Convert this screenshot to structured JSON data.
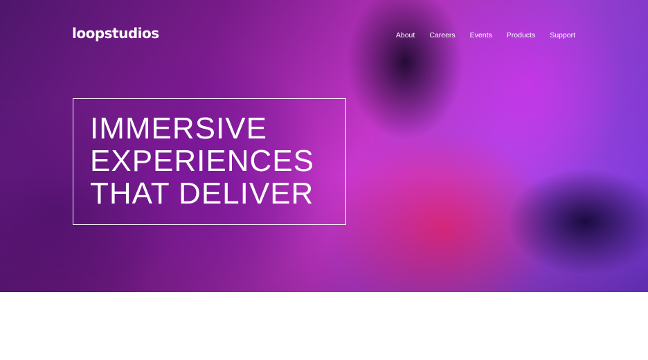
{
  "header": {
    "logo": "loopstudios",
    "nav": [
      "About",
      "Careers",
      "Events",
      "Products",
      "Support"
    ]
  },
  "hero": {
    "headline_lines": [
      "IMMERSIVE",
      "EXPERIENCES",
      "THAT DELIVER"
    ]
  },
  "colors": {
    "text": "#ffffff",
    "hero_magenta": "#d33ad6",
    "hero_purple": "#8a1f9c",
    "page_background": "#ffffff"
  }
}
